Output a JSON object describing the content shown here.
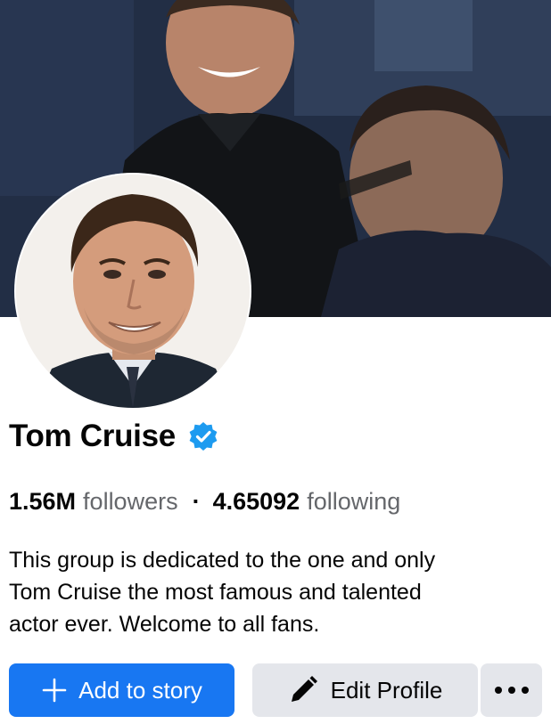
{
  "profile": {
    "name": "Tom Cruise",
    "verified_icon": "verified-badge-icon",
    "stats": {
      "followers_count": "1.56M",
      "followers_label": "followers",
      "separator": "·",
      "following_count": "4.65092",
      "following_label": "following"
    },
    "bio_lines": [
      "This group is dedicated to the one and only",
      "Tom Cruise the most famous and talented",
      "actor ever. Welcome to all fans."
    ]
  },
  "actions": {
    "add_story_label": "Add to story",
    "add_story_icon": "plus-icon",
    "edit_profile_label": "Edit Profile",
    "edit_profile_icon": "pencil-icon",
    "more_icon": "more-dots-icon"
  },
  "colors": {
    "accent": "#1877f2",
    "verified": "#1d9bf0",
    "secondary_button": "#e4e6eb",
    "muted_text": "#65676b"
  }
}
